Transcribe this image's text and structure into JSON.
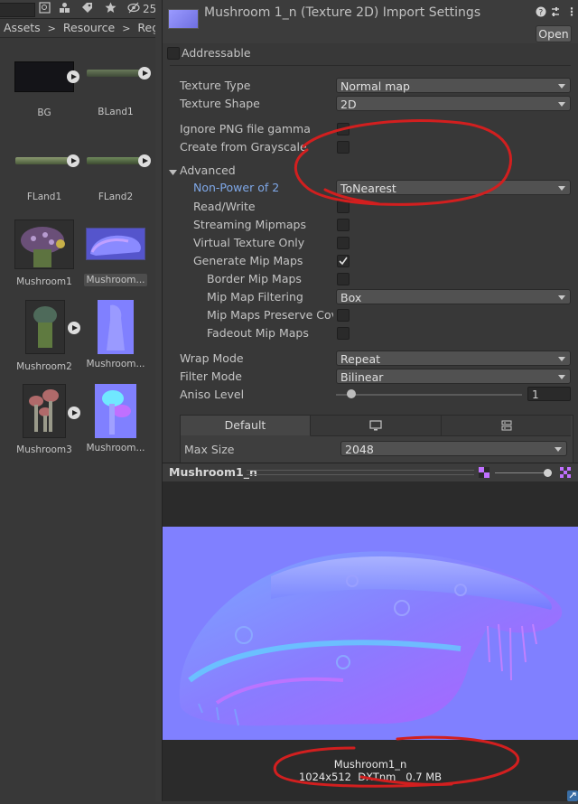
{
  "toolbar": {
    "hidden_count": "25"
  },
  "breadcrumb": [
    "Assets",
    "Resource",
    "Region"
  ],
  "assets": [
    {
      "label": "BG"
    },
    {
      "label": "BLand1"
    },
    {
      "label": "FLand1"
    },
    {
      "label": "FLand2"
    },
    {
      "label": "Mushroom1"
    },
    {
      "label": "Mushroom..."
    },
    {
      "label": "Mushroom2"
    },
    {
      "label": "Mushroom..."
    },
    {
      "label": "Mushroom3"
    },
    {
      "label": "Mushroom..."
    }
  ],
  "inspector": {
    "title": "Mushroom 1_n (Texture 2D) Import Settings",
    "open_label": "Open",
    "addressable_label": "Addressable",
    "texture_type_label": "Texture Type",
    "texture_type_value": "Normal map",
    "texture_shape_label": "Texture Shape",
    "texture_shape_value": "2D",
    "ignore_png_label": "Ignore PNG file gamma",
    "create_gray_label": "Create from Grayscale",
    "advanced_label": "Advanced",
    "npot_label": "Non-Power of 2",
    "npot_value": "ToNearest",
    "readwrite_label": "Read/Write",
    "streaming_label": "Streaming Mipmaps",
    "virtual_label": "Virtual Texture Only",
    "genmip_label": "Generate Mip Maps",
    "border_mip_label": "Border Mip Maps",
    "mip_filter_label": "Mip Map Filtering",
    "mip_filter_value": "Box",
    "mip_preserve_label": "Mip Maps Preserve Cove",
    "fadeout_label": "Fadeout Mip Maps",
    "wrap_label": "Wrap Mode",
    "wrap_value": "Repeat",
    "filter_label": "Filter Mode",
    "filter_value": "Bilinear",
    "aniso_label": "Aniso Level",
    "aniso_value": "1",
    "tab_default": "Default",
    "maxsize_label": "Max Size",
    "maxsize_value": "2048",
    "preview_title": "Mushroom1_n",
    "preview_name": "Mushroom1_n",
    "preview_info": "1024x512  DXTnm   0.7 MB"
  },
  "colors": {
    "annotation": "#d21f1f",
    "normal_map": "#8080ff",
    "link_blue": "#7fa8e8"
  }
}
